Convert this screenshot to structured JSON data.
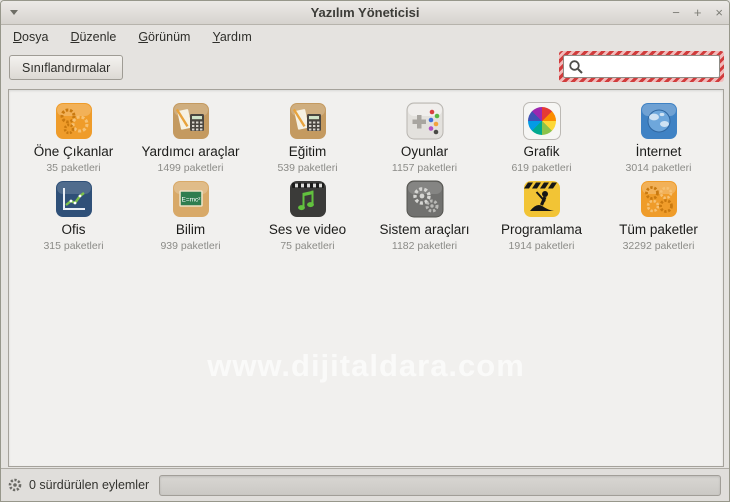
{
  "window": {
    "title": "Yazılım Yöneticisi",
    "minimize": "−",
    "maximize": "+",
    "close": "×"
  },
  "menubar": {
    "items": [
      {
        "accel": "D",
        "rest": "osya"
      },
      {
        "accel": "D",
        "rest": "üzenle"
      },
      {
        "accel": "G",
        "rest": "örünüm"
      },
      {
        "accel": "Y",
        "rest": "ardım"
      }
    ]
  },
  "toolbar": {
    "categories_button": "Sınıflandırmalar",
    "search_value": ""
  },
  "categories": [
    {
      "name": "Öne Çıkanlar",
      "count": "35 paketleri"
    },
    {
      "name": "Yardımcı araçlar",
      "count": "1499 paketleri"
    },
    {
      "name": "Eğitim",
      "count": "539 paketleri"
    },
    {
      "name": "Oyunlar",
      "count": "1157 paketleri"
    },
    {
      "name": "Grafik",
      "count": "619 paketleri"
    },
    {
      "name": "İnternet",
      "count": "3014 paketleri"
    },
    {
      "name": "Ofis",
      "count": "315 paketleri"
    },
    {
      "name": "Bilim",
      "count": "939 paketleri"
    },
    {
      "name": "Ses ve video",
      "count": "75 paketleri"
    },
    {
      "name": "Sistem araçları",
      "count": "1182 paketleri"
    },
    {
      "name": "Programlama",
      "count": "1914 paketleri"
    },
    {
      "name": "Tüm paketler",
      "count": "32292 paketleri"
    }
  ],
  "watermark": "www.dijitaldara.com",
  "statusbar": {
    "label": "0 sürdürülen eylemler"
  },
  "colors": {
    "search_highlight_red": "#d03c3c",
    "window_border": "#97978b",
    "panel_bg": "#f1f0ee"
  }
}
